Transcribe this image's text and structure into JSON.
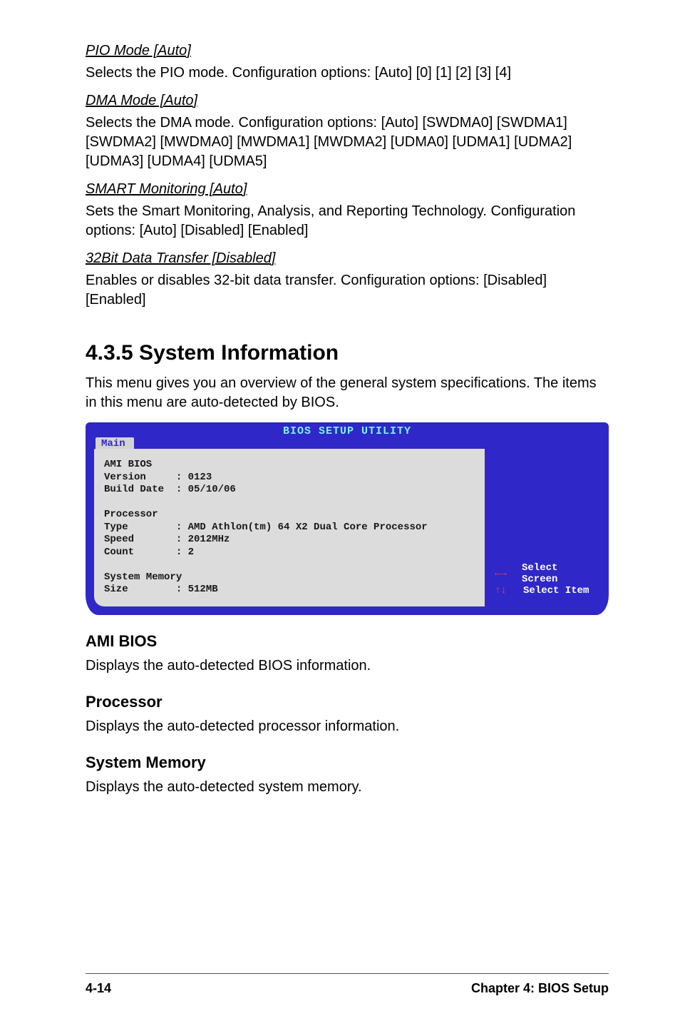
{
  "settings": {
    "pio": {
      "heading": "PIO Mode [Auto]",
      "desc": "Selects the PIO mode. Configuration options: [Auto] [0] [1] [2] [3] [4]"
    },
    "dma": {
      "heading": "DMA Mode [Auto]",
      "desc": "Selects the DMA mode. Configuration options: [Auto] [SWDMA0] [SWDMA1] [SWDMA2] [MWDMA0] [MWDMA1] [MWDMA2] [UDMA0] [UDMA1] [UDMA2] [UDMA3] [UDMA4] [UDMA5]"
    },
    "smart": {
      "heading": "SMART Monitoring [Auto]",
      "desc": "Sets the Smart Monitoring, Analysis, and Reporting Technology. Configuration options: [Auto] [Disabled] [Enabled]"
    },
    "bit32": {
      "heading": "32Bit Data Transfer [Disabled]",
      "desc": "Enables or disables 32-bit data transfer. Configuration options: [Disabled] [Enabled]"
    }
  },
  "section": {
    "title": "4.3.5  System Information",
    "intro": "This menu gives you an overview of the general system specifications. The items in this menu are auto-detected by BIOS."
  },
  "bios": {
    "title": "BIOS SETUP UTILITY",
    "tab": "Main",
    "panel_text": "AMI BIOS\nVersion     : 0123\nBuild Date  : 05/10/06\n\nProcessor\nType        : AMD Athlon(tm) 64 X2 Dual Core Processor\nSpeed       : 2012MHz\nCount       : 2\n\nSystem Memory\nSize        : 512MB",
    "nav": [
      {
        "arrows": "←→",
        "label": "Select Screen"
      },
      {
        "arrows": "↑↓",
        "label": "Select Item"
      }
    ]
  },
  "subsections": {
    "ami": {
      "title": "AMI BIOS",
      "desc": "Displays the auto-detected BIOS information."
    },
    "proc": {
      "title": "Processor",
      "desc": "Displays the auto-detected processor information."
    },
    "mem": {
      "title": "System Memory",
      "desc": "Displays the auto-detected system memory."
    }
  },
  "footer": {
    "left": "4-14",
    "right": "Chapter 4: BIOS Setup"
  }
}
